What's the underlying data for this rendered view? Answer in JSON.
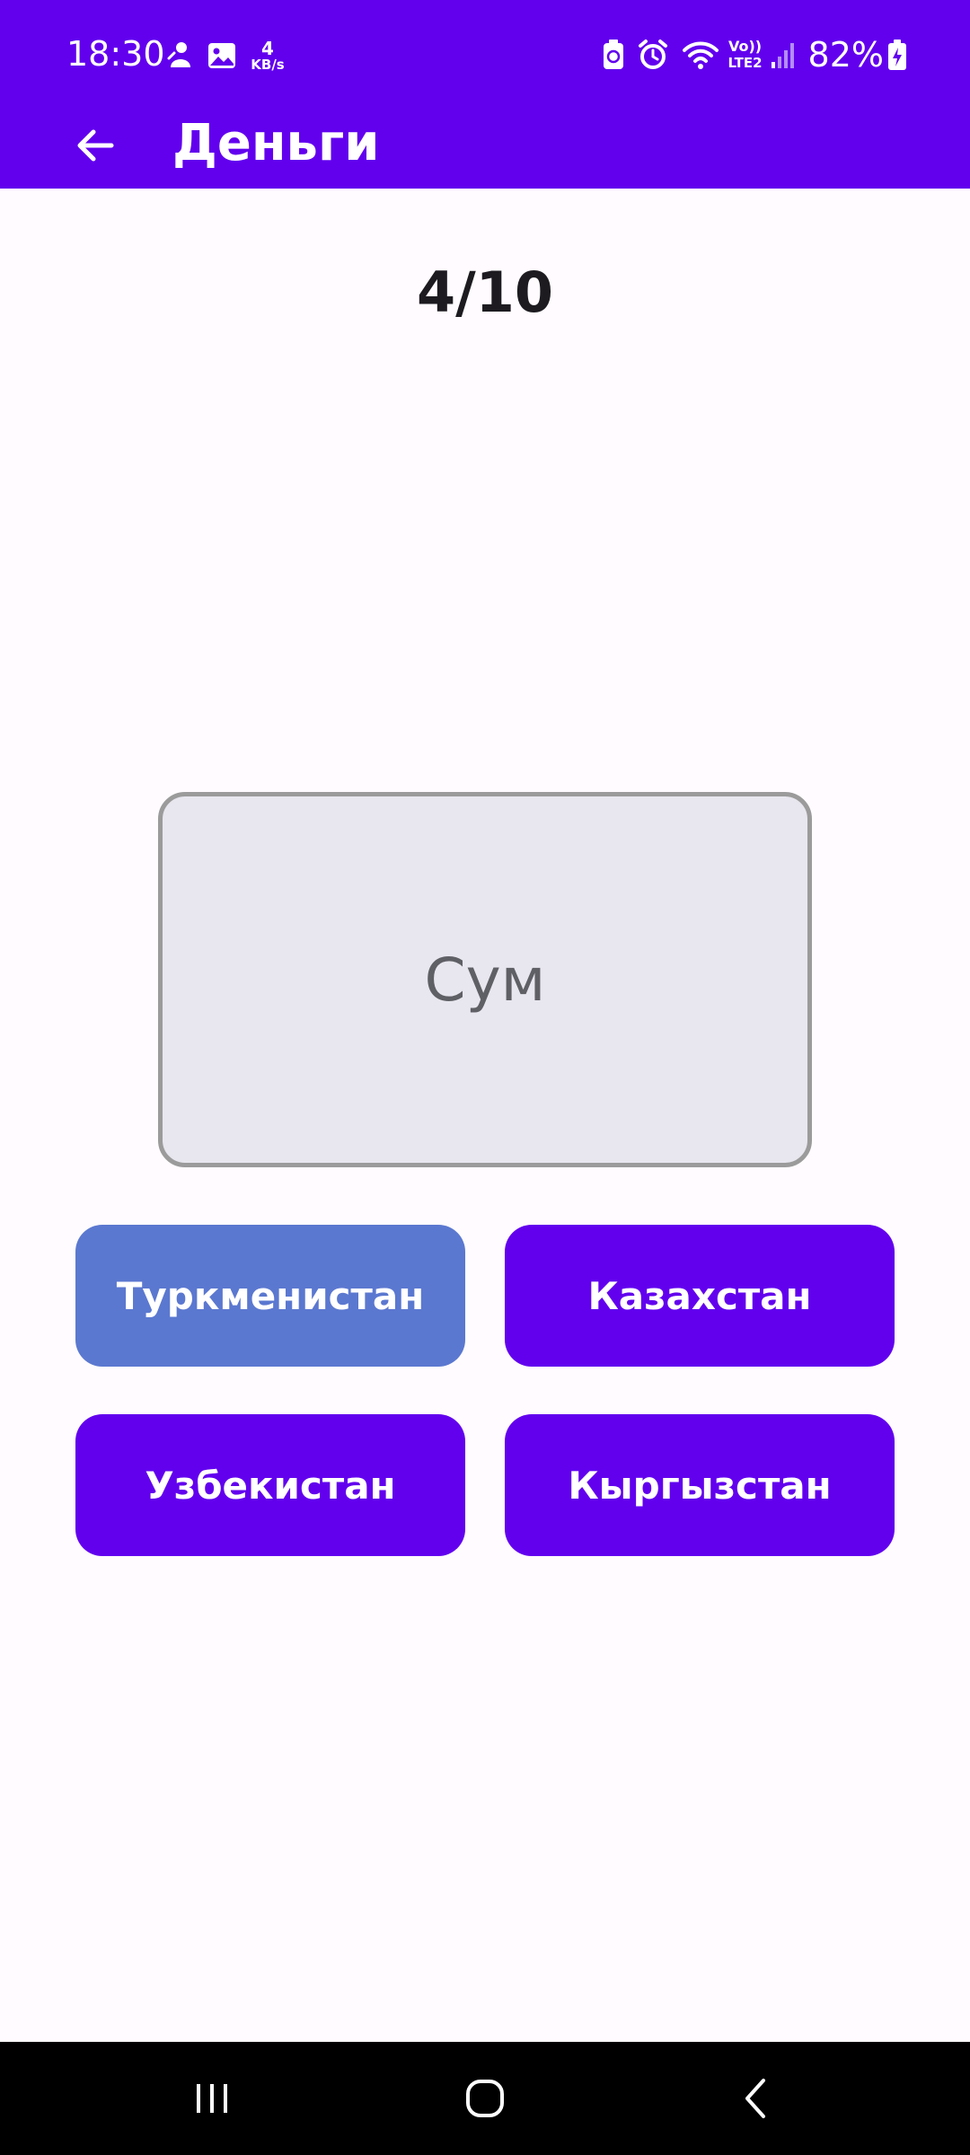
{
  "status_bar": {
    "time": "18:30",
    "network_speed_value": "4",
    "network_speed_unit": "KB/s",
    "volte_top": "Vo))",
    "volte_bottom": "LTE2",
    "battery": "82%"
  },
  "app_bar": {
    "title": "Деньги"
  },
  "quiz": {
    "progress": "4/10",
    "current": 4,
    "total": 10,
    "word": "Сум",
    "answers": [
      {
        "label": "Туркменистан",
        "selected": true
      },
      {
        "label": "Казахстан",
        "selected": false
      },
      {
        "label": "Узбекистан",
        "selected": false
      },
      {
        "label": "Кыргызстан",
        "selected": false
      }
    ]
  },
  "colors": {
    "primary": "#6200ee",
    "selected_answer": "#5b78d0",
    "background": "#fffbfe",
    "card_background": "#e8e6ee",
    "card_border": "#9b9b9b"
  },
  "icons": {
    "back": "arrow-left-icon",
    "nav_recents": "recents-icon",
    "nav_home": "home-icon",
    "nav_back": "chevron-left-icon"
  }
}
